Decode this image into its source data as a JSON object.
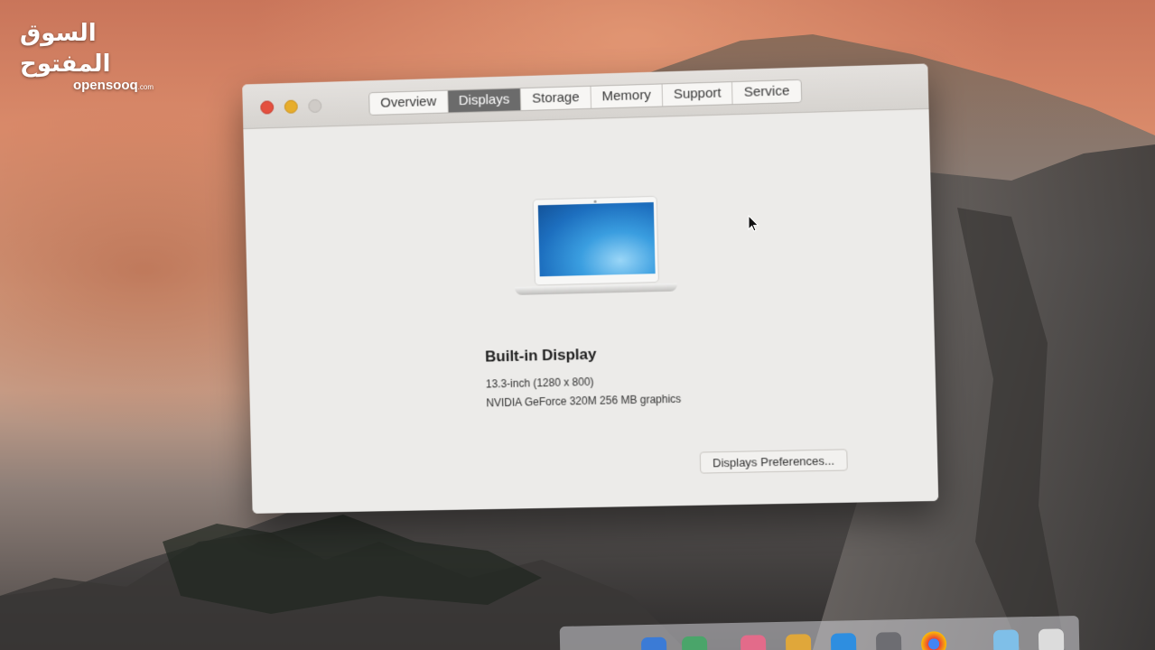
{
  "watermark": {
    "arabic": "السوق المفتوح",
    "latin": "opensooq",
    "suffix": ".com"
  },
  "window": {
    "tabs": [
      {
        "label": "Overview",
        "active": false
      },
      {
        "label": "Displays",
        "active": true
      },
      {
        "label": "Storage",
        "active": false
      },
      {
        "label": "Memory",
        "active": false
      },
      {
        "label": "Support",
        "active": false
      },
      {
        "label": "Service",
        "active": false
      }
    ],
    "display": {
      "title": "Built-in Display",
      "size": "13.3-inch (1280 x 800)",
      "graphics": "NVIDIA GeForce 320M 256 MB graphics"
    },
    "prefs_button_label": "Displays Preferences..."
  },
  "colors": {
    "close": "#e4503f",
    "minimize": "#e7ad2c",
    "zoom_disabled": "#cfcbc7",
    "active_tab": "#6b6b6b"
  },
  "icons": [
    "close-button",
    "minimize-button",
    "zoom-button",
    "laptop-icon",
    "mouse-cursor-icon"
  ]
}
